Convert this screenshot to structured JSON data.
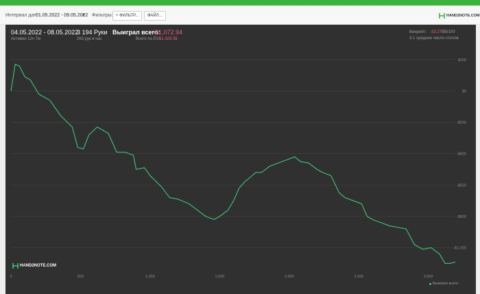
{
  "toolbar": {
    "interval_label": "Интервал дат:",
    "date_range": "01.05.2022 - 09.05.2022",
    "filters_label": "Фильтры:",
    "filters_button": "+ ФИЛЬТР...",
    "file_button": "ФАЙЛ..."
  },
  "brand": {
    "logo_text": "HAND2NOTE.COM"
  },
  "summary": {
    "period": "04.05.2022 - 08.05.2022",
    "active": "Активен 12ч 7м",
    "hands": "3 194 Руки",
    "hands_rate": "263 рук в час",
    "won_label": "Выиграл всего:",
    "won_value": "-$1,072.94",
    "ev_label": "Всего по EV:",
    "ev_value": "-$1,329.36",
    "winrate_label": "Винрейт:",
    "winrate_value": "-33.27",
    "winrate_unit": "BB/100",
    "tables_text": "3.1 среднее число столов"
  },
  "chart_data": {
    "type": "line",
    "series": [
      {
        "name": "Выиграл всего",
        "x": [
          0,
          30,
          60,
          100,
          140,
          200,
          280,
          360,
          440,
          480,
          520,
          560,
          620,
          700,
          760,
          820,
          880,
          900,
          960,
          1000,
          1080,
          1140,
          1200,
          1280,
          1340,
          1400,
          1460,
          1500,
          1560,
          1600,
          1640,
          1680,
          1720,
          1760,
          1800,
          1860,
          1920,
          1980,
          2040,
          2080,
          2140,
          2200,
          2240,
          2300,
          2360,
          2400,
          2460,
          2520,
          2560,
          2600,
          2660,
          2720,
          2780,
          2840,
          2900,
          2960,
          3020,
          3080,
          3120,
          3160,
          3194
        ],
        "y": [
          0,
          170,
          160,
          90,
          70,
          -20,
          -60,
          -160,
          -230,
          -360,
          -370,
          -280,
          -230,
          -270,
          -390,
          -390,
          -410,
          -500,
          -490,
          -540,
          -610,
          -680,
          -690,
          -720,
          -760,
          -800,
          -820,
          -800,
          -760,
          -700,
          -620,
          -580,
          -550,
          -520,
          -520,
          -480,
          -460,
          -440,
          -420,
          -450,
          -460,
          -500,
          -520,
          -540,
          -650,
          -680,
          -700,
          -720,
          -800,
          -820,
          -840,
          -860,
          -870,
          -880,
          -980,
          -1010,
          -1000,
          -1040,
          -1100,
          -1100,
          -1090
        ]
      }
    ],
    "x_ticks": [
      "0",
      "500",
      "1,000",
      "1,500",
      "2,000",
      "2,500",
      "3,000"
    ],
    "x_tick_values": [
      0,
      500,
      1000,
      1500,
      2000,
      2500,
      3000
    ],
    "y_ticks": [
      "$200",
      "$0",
      "-$200",
      "-$400",
      "-$600",
      "-$800",
      "-$1,000"
    ],
    "y_tick_values": [
      200,
      0,
      -200,
      -400,
      -600,
      -800,
      -1000
    ],
    "xlim": [
      0,
      3194
    ],
    "ylim": [
      -1120,
      230
    ],
    "grid": true,
    "legend": "bottom-right",
    "colors": {
      "line": "#3cc878",
      "grid": "#444444",
      "tick": "#8a8a8a"
    }
  }
}
